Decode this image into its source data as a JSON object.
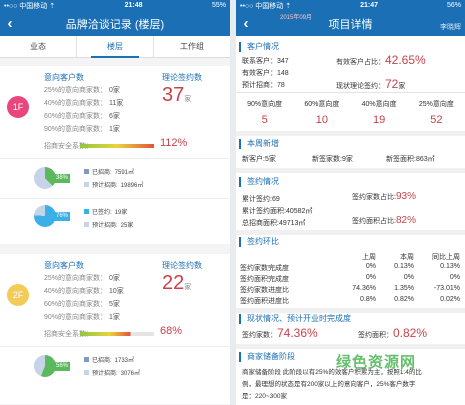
{
  "left": {
    "status": {
      "carrier": "••○○ 中国移动 ⇡",
      "time": "21:48",
      "battery": "55%"
    },
    "title": "品牌洽谈记录 (楼层)",
    "tabs": [
      "业态",
      "楼层",
      "工作组"
    ],
    "floors": [
      {
        "label": "1F",
        "color": "#e8467c",
        "intent_title": "意向客户数",
        "rows": [
          {
            "label": "25%的意向商家数：",
            "value": "0家"
          },
          {
            "label": "40%的意向商家数：",
            "value": "11家"
          },
          {
            "label": "60%的意向商家数：",
            "value": "6家"
          },
          {
            "label": "90%的意向商家数：",
            "value": "1家"
          }
        ],
        "theory_label": "理论签约数",
        "theory_value": "37",
        "theory_unit": "家",
        "safety_label": "招商安全系数：",
        "safety_value": "112%",
        "safety_fill": 1.0,
        "pies": [
          {
            "pct": "38%",
            "pct_color": "#5cb85c",
            "fill": 0.38,
            "a_label": "已招商:",
            "a_value": "7591㎡",
            "b_label": "预计招商:",
            "b_value": "19896㎡"
          },
          {
            "pct": "76%",
            "pct_color": "#3bb0e6",
            "fill": 0.76,
            "a_label": "已签约:",
            "a_value": "19家",
            "b_label": "预计招商:",
            "b_value": "25家"
          }
        ]
      },
      {
        "label": "2F",
        "color": "#f3cb57",
        "intent_title": "意向客户数",
        "rows": [
          {
            "label": "25%的意向商家数：",
            "value": "0家"
          },
          {
            "label": "40%的意向商家数：",
            "value": "10家"
          },
          {
            "label": "60%的意向商家数：",
            "value": "5家"
          },
          {
            "label": "90%的意向商家数：",
            "value": "1家"
          }
        ],
        "theory_label": "理论签约数",
        "theory_value": "22",
        "theory_unit": "家",
        "safety_label": "招商安全系数：",
        "safety_value": "68%",
        "safety_fill": 0.68,
        "pies": [
          {
            "pct": "56%",
            "pct_color": "#5cb85c",
            "fill": 0.56,
            "a_label": "已招商:",
            "a_value": "1733㎡",
            "b_label": "预计招商:",
            "b_value": "3076㎡"
          }
        ]
      }
    ]
  },
  "right": {
    "status": {
      "carrier": "••○○ 中国移动 ⇡",
      "time": "21:47",
      "battery": "56%"
    },
    "title": "项目详情",
    "overlay_text": "2015年09月",
    "overlay_brand": "李晓辉",
    "customer": {
      "heading": "客户情况",
      "contacts_label": "联系客户：347",
      "valid_label": "有效客户：148",
      "expected_label": "预计招商：78",
      "valid_ratio_label": "有效客户占比：",
      "valid_ratio": "42.65%",
      "signed_label": "现状理论签约：",
      "signed_value": "72",
      "signed_unit": "家",
      "grid_labels": [
        "90%意向度",
        "60%意向度",
        "40%意向度",
        "25%意向度"
      ],
      "grid_values": [
        "5",
        "10",
        "19",
        "52"
      ]
    },
    "week": {
      "heading": "本周新增",
      "items": [
        "新客户:5家",
        "新签家数:9家",
        "新签面积:863㎡"
      ]
    },
    "sign": {
      "heading": "签约情况",
      "signed_count": "累计签约:69",
      "signed_area": "累计签约面积:40582㎡",
      "total_area": "总招商面积:49713㎡",
      "count_ratio_label": "签约家数占比:",
      "count_ratio": "93%",
      "area_ratio_label": "签约面积占比:",
      "area_ratio": "82%"
    },
    "compare": {
      "heading": "签约环比",
      "headers": [
        "",
        "上周",
        "本周",
        "同比上周"
      ],
      "rows": [
        [
          "签约家数完成度",
          "0%",
          "0.13%",
          "0.13%"
        ],
        [
          "签约面积完成度",
          "0%",
          "0%",
          "0%"
        ],
        [
          "签约家数进度比",
          "74.36%",
          "1.35%",
          "-73.01%"
        ],
        [
          "签约面积进度比",
          "0.8%",
          "0.82%",
          "0.02%"
        ]
      ]
    },
    "forecast": {
      "heading": "现状情况、预计开业时完成度",
      "count_label": "签约家数：",
      "count_value": "74.36%",
      "area_label": "签约面积：",
      "area_value": "0.82%"
    },
    "reserve": {
      "heading": "商家储备阶段",
      "lines": [
        "商家储备阶段 此阶段以有25%的效客户积累为主，按照1:4的比",
        "例，最理想的状态是有200家以上的意向客户，25%客户数字",
        "是：220~300家"
      ]
    },
    "watermark": "绿色资源网"
  },
  "colors": {
    "brand": "#1b6fb5",
    "accent_red": "#c9414a",
    "green": "#5cb85c",
    "cyan": "#3bb0e6"
  }
}
